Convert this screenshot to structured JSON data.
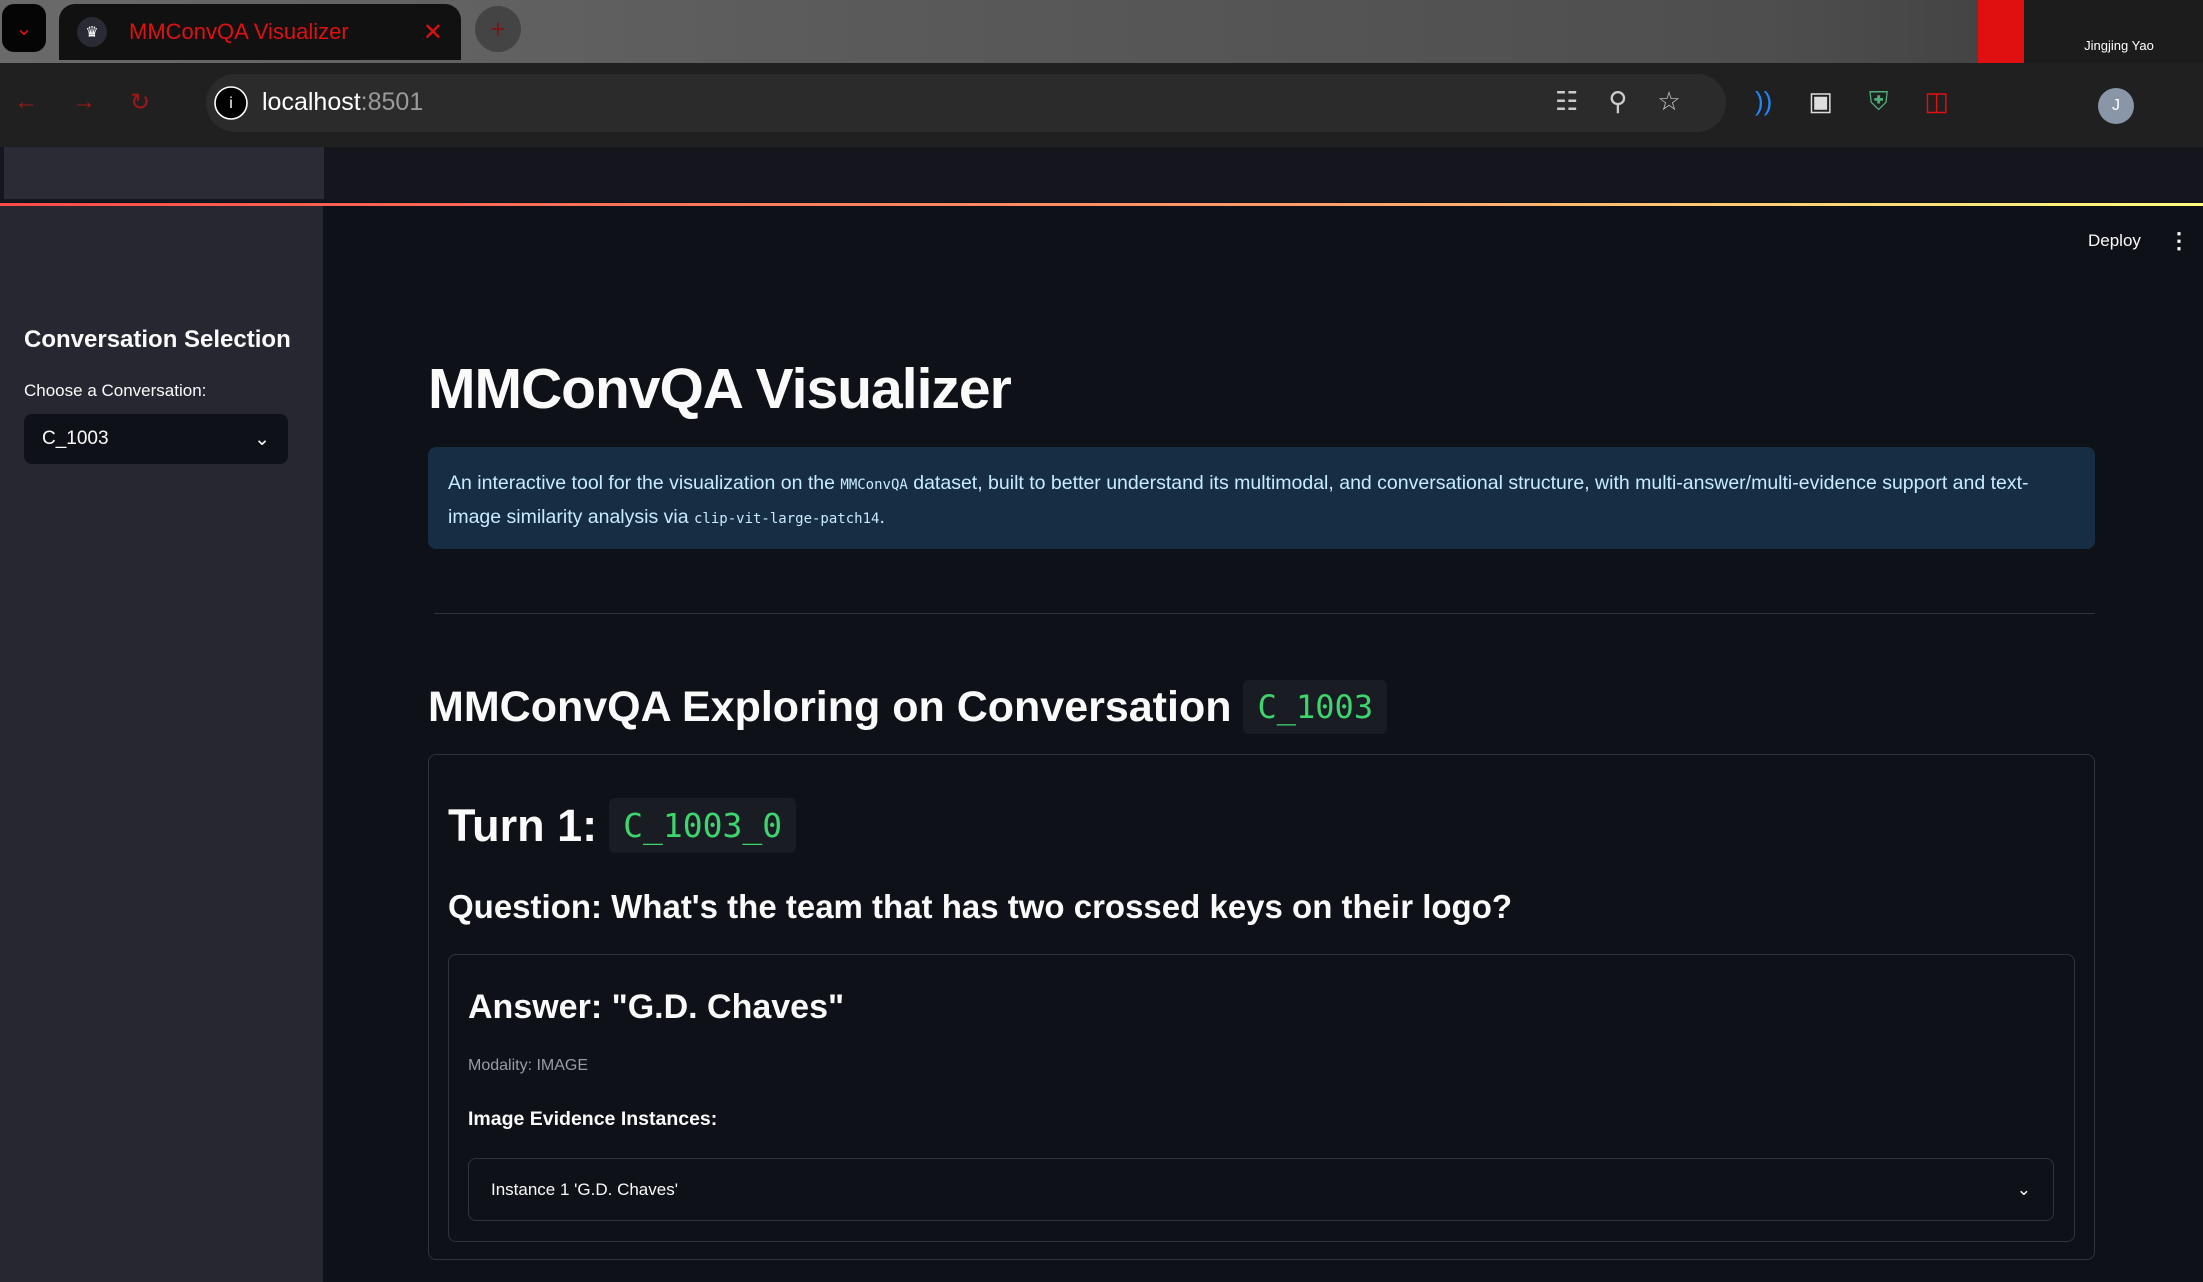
{
  "browser": {
    "tab_title": "MMConvQA Visualizer",
    "url_host": "localhost",
    "url_port": ":8501",
    "profile_name": "Jingjing Yao",
    "profile_initial": "J",
    "icons": [
      "tab-menu-icon",
      "crown-favicon-icon",
      "close-icon",
      "plus-icon",
      "back-icon",
      "forward-icon",
      "reload-icon",
      "info-icon",
      "translate-icon",
      "zoom-out-icon",
      "star-icon",
      "wave-extension-icon",
      "reader-extension-icon",
      "shield-check-extension-icon",
      "puzzle-extension-icon"
    ]
  },
  "header": {
    "deploy_label": "Deploy"
  },
  "sidebar": {
    "title": "Conversation Selection",
    "select_label": "Choose a Conversation:",
    "select_value": "C_1003"
  },
  "main": {
    "title": "MMConvQA Visualizer",
    "info_text_1": "An interactive tool for the visualization on the ",
    "info_code_1": "MMConvQA",
    "info_text_2": " dataset, built to better understand its multimodal, and conversational structure, with multi-answer/multi-evidence support and text-image similarity analysis via ",
    "info_code_2": "clip-vit-large-patch14",
    "info_text_3": ".",
    "section_title": "MMConvQA Exploring on Conversation",
    "conversation_id": "C_1003",
    "turn_label": "Turn 1:",
    "turn_id": "C_1003_0",
    "question": "Question: What's the team that has two crossed keys on their logo?",
    "answer": "Answer: \"G.D. Chaves\"",
    "modality": "Modality: IMAGE",
    "evidence_label": "Image Evidence Instances:",
    "evidence_instances": [
      {
        "label": "Instance 1 'G.D. Chaves'"
      }
    ]
  },
  "colors": {
    "accent_green": "#3dd56d",
    "info_bg": "#172d43",
    "sidebar_bg": "#262730",
    "main_bg": "#0e1117",
    "browser_accent": "#e01010"
  }
}
